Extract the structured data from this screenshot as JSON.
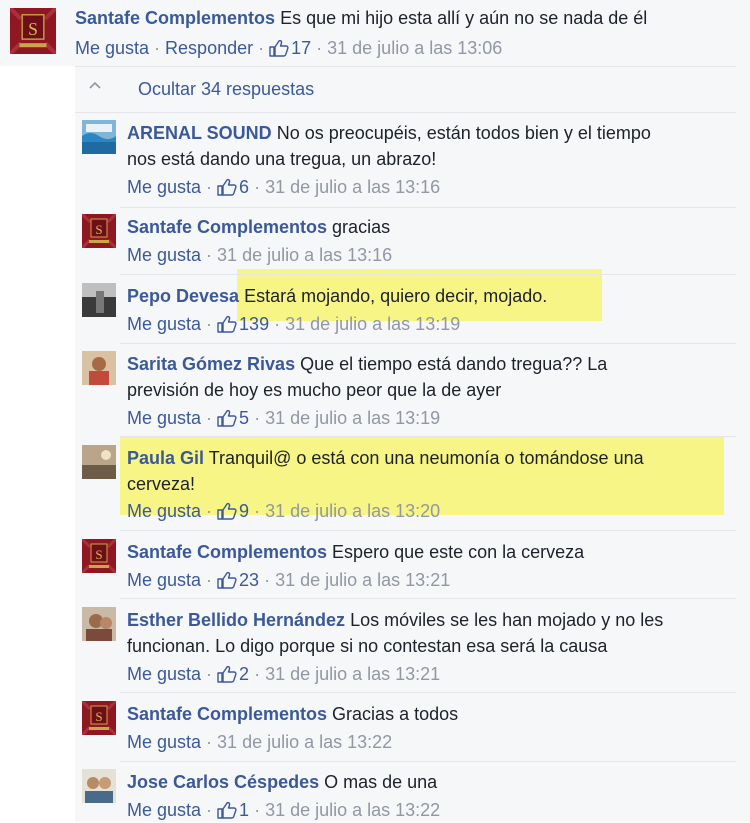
{
  "top_comment": {
    "author": "Santafe Complementos",
    "text": "Es que mi hijo esta allí y aún no se nada de él",
    "like": "Me gusta",
    "sep1": " · ",
    "reply": "Responder",
    "sep2": " · ",
    "likes": "17",
    "sep3": " · ",
    "time": "31 de julio a las 13:06"
  },
  "hide_replies": "Ocultar 34 respuestas",
  "replies": [
    {
      "author": "ARENAL SOUND",
      "text1": " No os preocupéis, están todos bien y el tiempo",
      "text2": "nos está dando una tregua, un abrazo!",
      "like": "Me gusta",
      "likes": "6",
      "time": "31 de julio a las 13:16"
    },
    {
      "author": "Santafe Complementos",
      "text1": " gracias",
      "like": "Me gusta",
      "likes": "",
      "time": "31 de julio a las 13:16"
    },
    {
      "author": "Pepo Devesa",
      "text1": " Estará mojando, quiero decir, mojado.",
      "like": "Me gusta",
      "likes": "139",
      "time": "31 de julio a las 13:19"
    },
    {
      "author": "Sarita Gómez Rivas",
      "text1": " Que el tiempo está dando tregua?? La",
      "text2": "previsión de hoy es mucho peor que la de ayer",
      "like": "Me gusta",
      "likes": "5",
      "time": "31 de julio a las 13:19"
    },
    {
      "author": "Paula Gil",
      "text1": " Tranquil@ o está con una neumonía o tomándose una",
      "text2": "cerveza!",
      "like": "Me gusta",
      "likes": "9",
      "time": "31 de julio a las 13:20"
    },
    {
      "author": "Santafe Complementos",
      "text1": " Espero que este con la cerveza",
      "like": "Me gusta",
      "likes": "23",
      "time": "31 de julio a las 13:21"
    },
    {
      "author": "Esther Bellido Hernández",
      "text1": " Los móviles se les han mojado y no les",
      "text2": "funcionan. Lo digo porque si no contestan esa será la causa",
      "like": "Me gusta",
      "likes": "2",
      "time": "31 de julio a las 13:21"
    },
    {
      "author": "Santafe Complementos",
      "text1": " Gracias a todos",
      "like": "Me gusta",
      "likes": "",
      "time": "31 de julio a las 13:22"
    },
    {
      "author": "Jose Carlos Céspedes",
      "text1": " O mas de una",
      "like": "Me gusta",
      "likes": "1",
      "time": "31 de julio a las 13:22"
    }
  ],
  "sep": " · ",
  "colors": {
    "link": "#3b5998",
    "meta": "#9197a3",
    "highlight": "#f5f46d",
    "background": "#f6f7f9"
  },
  "icons": [
    "santafe-logo-avatar",
    "arenal-sound-avatar",
    "user-avatar",
    "thumbs-up-icon",
    "chevron-up-icon"
  ]
}
